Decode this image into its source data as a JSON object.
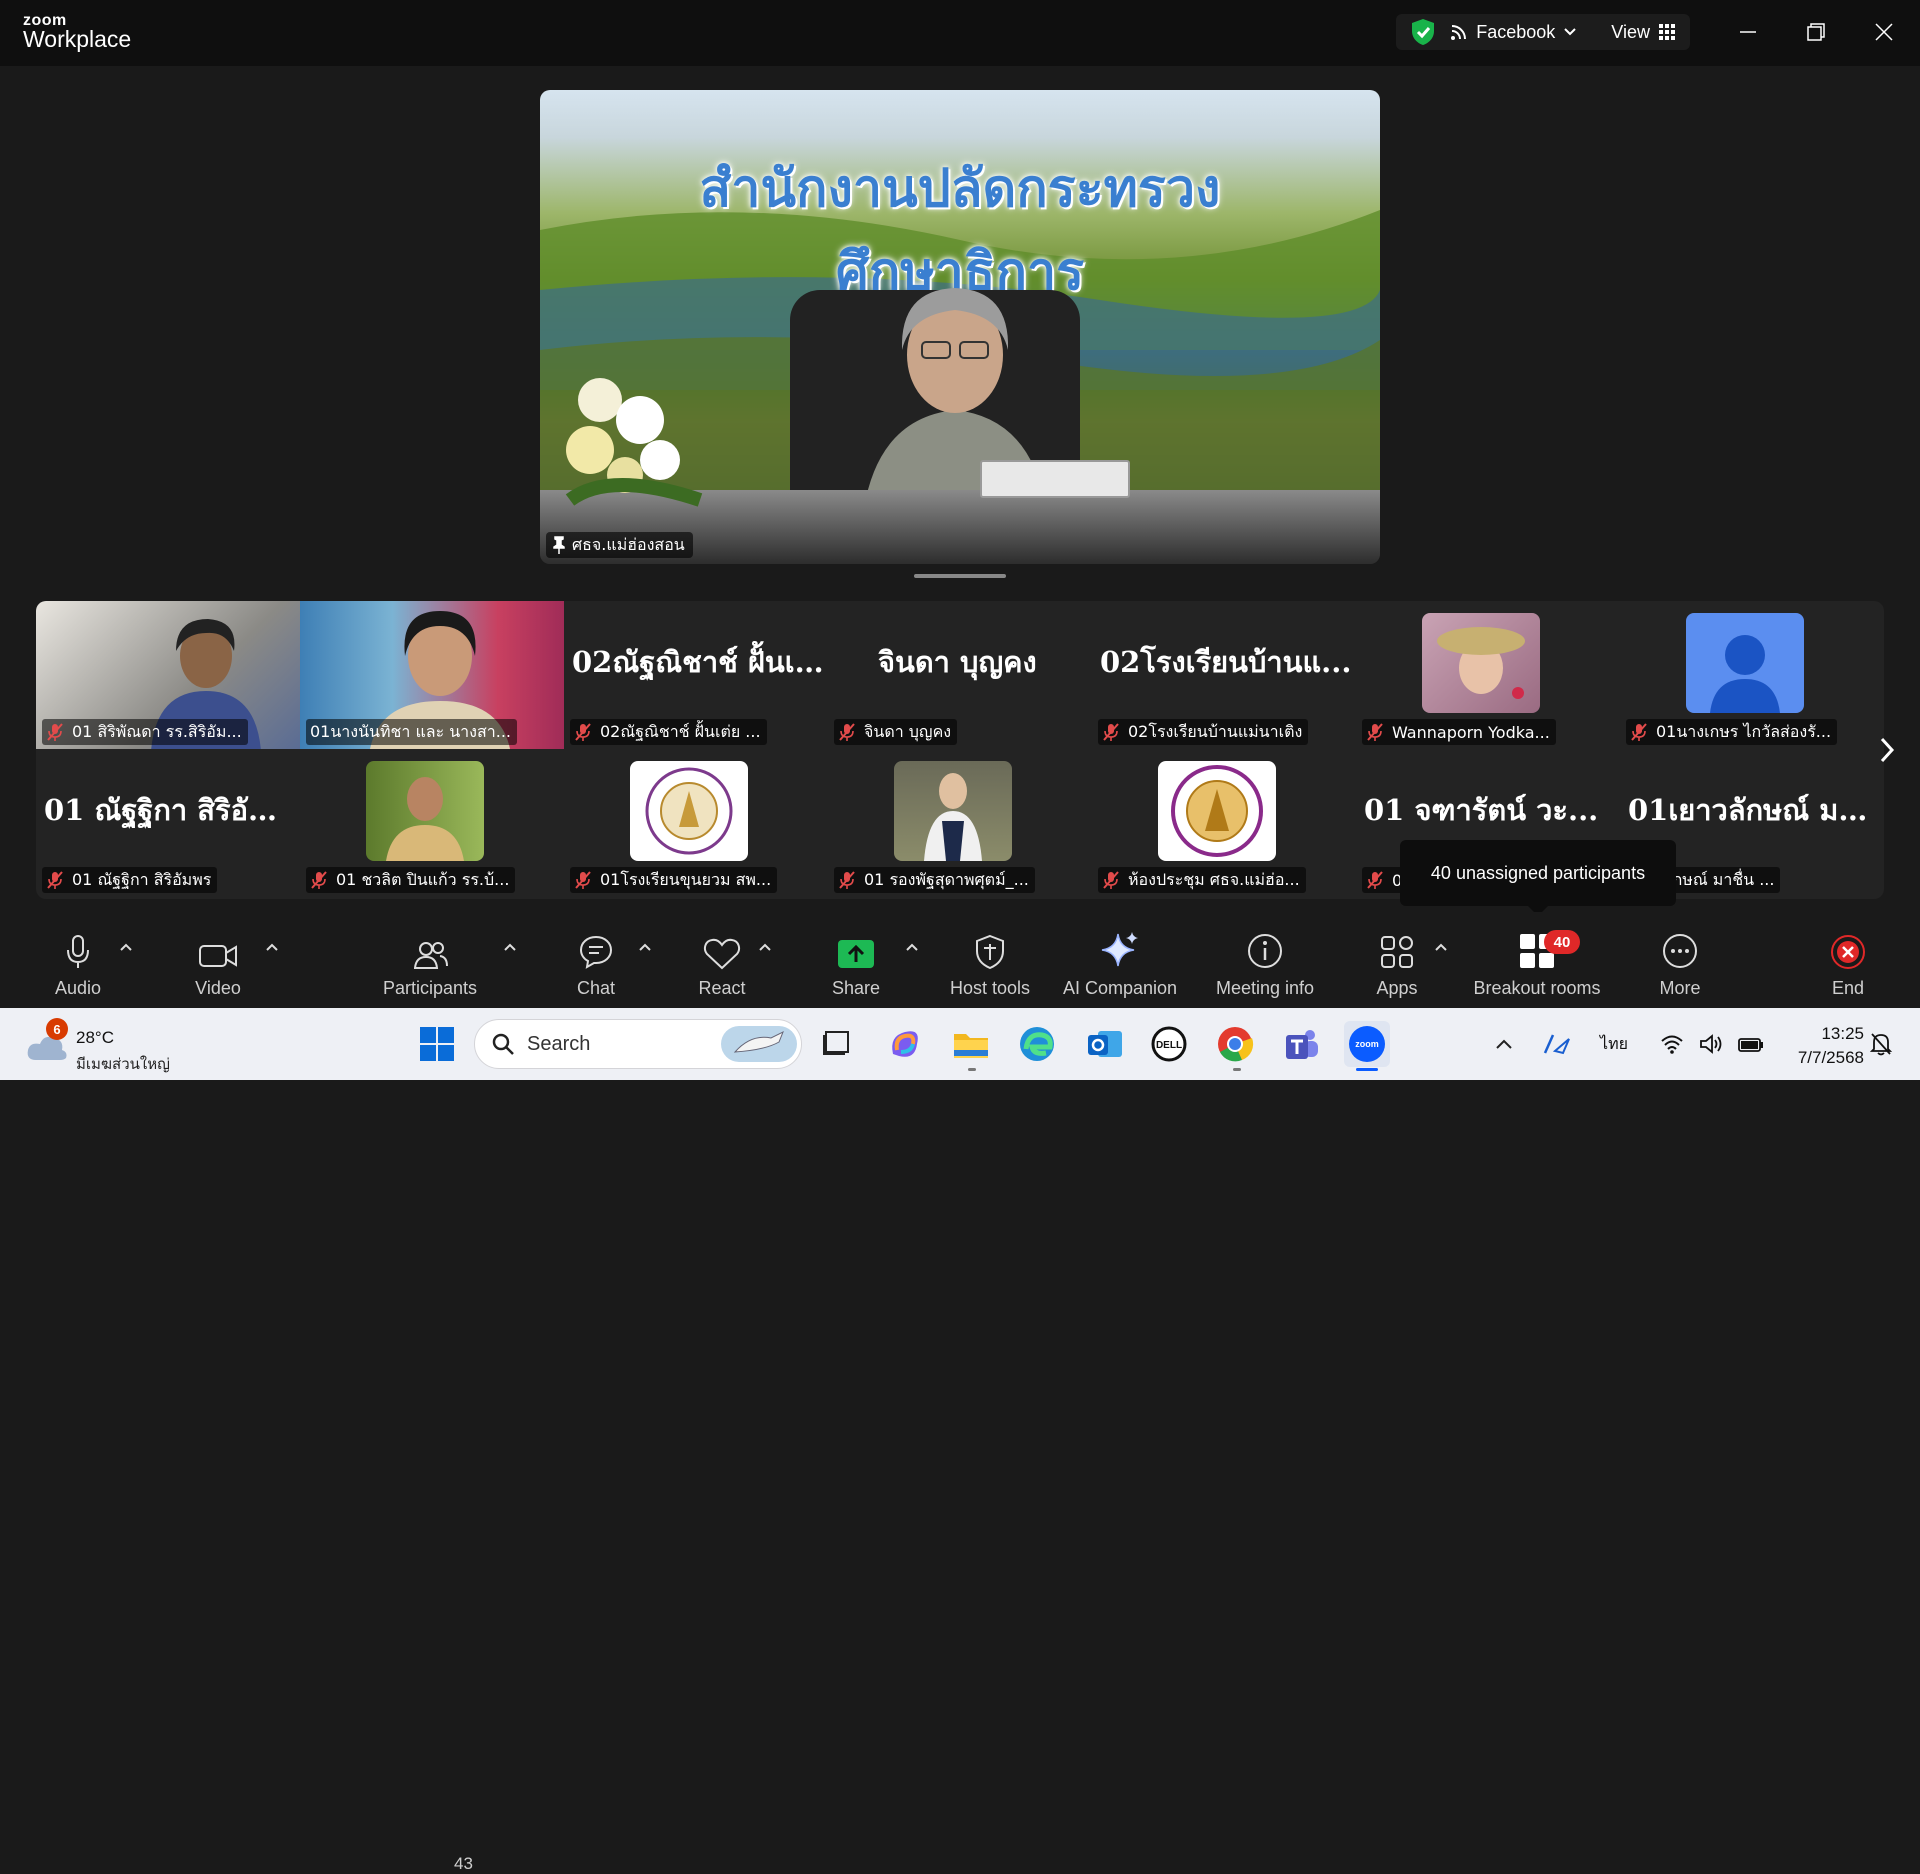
{
  "titlebar": {
    "logo_small": "zoom",
    "logo_big": "Workplace",
    "livestream_label": "Facebook",
    "view_label": "View"
  },
  "main_video": {
    "banner_text": "สำนักงานปลัดกระทรวงศึกษาธิการ",
    "pinned_name": "ศธจ.แม่ฮ่องสอน"
  },
  "gallery": {
    "row1": [
      {
        "big": "",
        "name": "01 สิริพัณดา รร.สิริอัม..."
      },
      {
        "big": "",
        "name": "01นางนันทิชา และ นางสา..."
      },
      {
        "big": "02ณัฐณิชาช์  ฝั้นเ...",
        "name": "02ณัฐณิชาช์ ฝั้นเต่ย ..."
      },
      {
        "big": "จินดา บุญคง",
        "name": "จินดา บุญคง"
      },
      {
        "big": "02โรงเรียนบ้านแ...",
        "name": "02โรงเรียนบ้านแม่นาเติง"
      },
      {
        "big": "",
        "name": "Wannaporn Yodka..."
      },
      {
        "big": "",
        "name": "01นางเกษร ไกวัลส่องรั..."
      }
    ],
    "row2": [
      {
        "big": "01 ณัฐฐิกา สิริอัม...",
        "name": "01 ณัฐฐิกา สิริอัมพร"
      },
      {
        "big": "",
        "name": "01 ชวลิต ปินแก้ว รร.บ้..."
      },
      {
        "big": "",
        "name": "01โรงเรียนขุนยวม สพ..."
      },
      {
        "big": "",
        "name": "01 รองพัฐสุดาพศุตม์_..."
      },
      {
        "big": "",
        "name": "ห้องประชุม ศธจ.แม่ฮ่อ..."
      },
      {
        "big": "01 จฑารัตน์ วะ...",
        "name": "0"
      },
      {
        "big": "01เยาวลักษณ์ มา...",
        "name": "เยาวลักษณ์ มาชื่น ..."
      }
    ]
  },
  "tooltip": "40 unassigned participants",
  "toolbar": {
    "audio": "Audio",
    "video": "Video",
    "participants": "Participants",
    "participants_count": "43",
    "chat": "Chat",
    "react": "React",
    "share": "Share",
    "host_tools": "Host tools",
    "ai_companion": "AI Companion",
    "meeting_info": "Meeting info",
    "apps": "Apps",
    "breakout_rooms": "Breakout rooms",
    "breakout_badge": "40",
    "more": "More",
    "end": "End"
  },
  "taskbar": {
    "weather_temp": "28°C",
    "weather_cond": "มีเมฆส่วนใหญ่",
    "weather_badge": "6",
    "search_placeholder": "Search",
    "lang": "ไทย",
    "time": "13:25",
    "date": "7/7/2568"
  },
  "colors": {
    "background": "#1a1a1a",
    "share_green": "#1db954",
    "badge_red": "#e02828",
    "end_red": "#e02828",
    "shield_green": "#19b34a"
  },
  "icons": [
    "shield-check-icon",
    "rss-icon",
    "chevron-down-icon",
    "grid-icon",
    "minimize-icon",
    "restore-icon",
    "close-icon",
    "pin-icon",
    "mic-off-icon",
    "chevron-right-icon",
    "microphone-icon",
    "camera-icon",
    "people-icon",
    "chat-bubble-icon",
    "heart-icon",
    "share-arrow-icon",
    "shield-icon",
    "sparkle-icon",
    "info-icon",
    "apps-icon",
    "grid-rooms-icon",
    "ellipsis-icon",
    "end-x-icon",
    "cloud-icon",
    "search-icon",
    "windows-icon"
  ]
}
